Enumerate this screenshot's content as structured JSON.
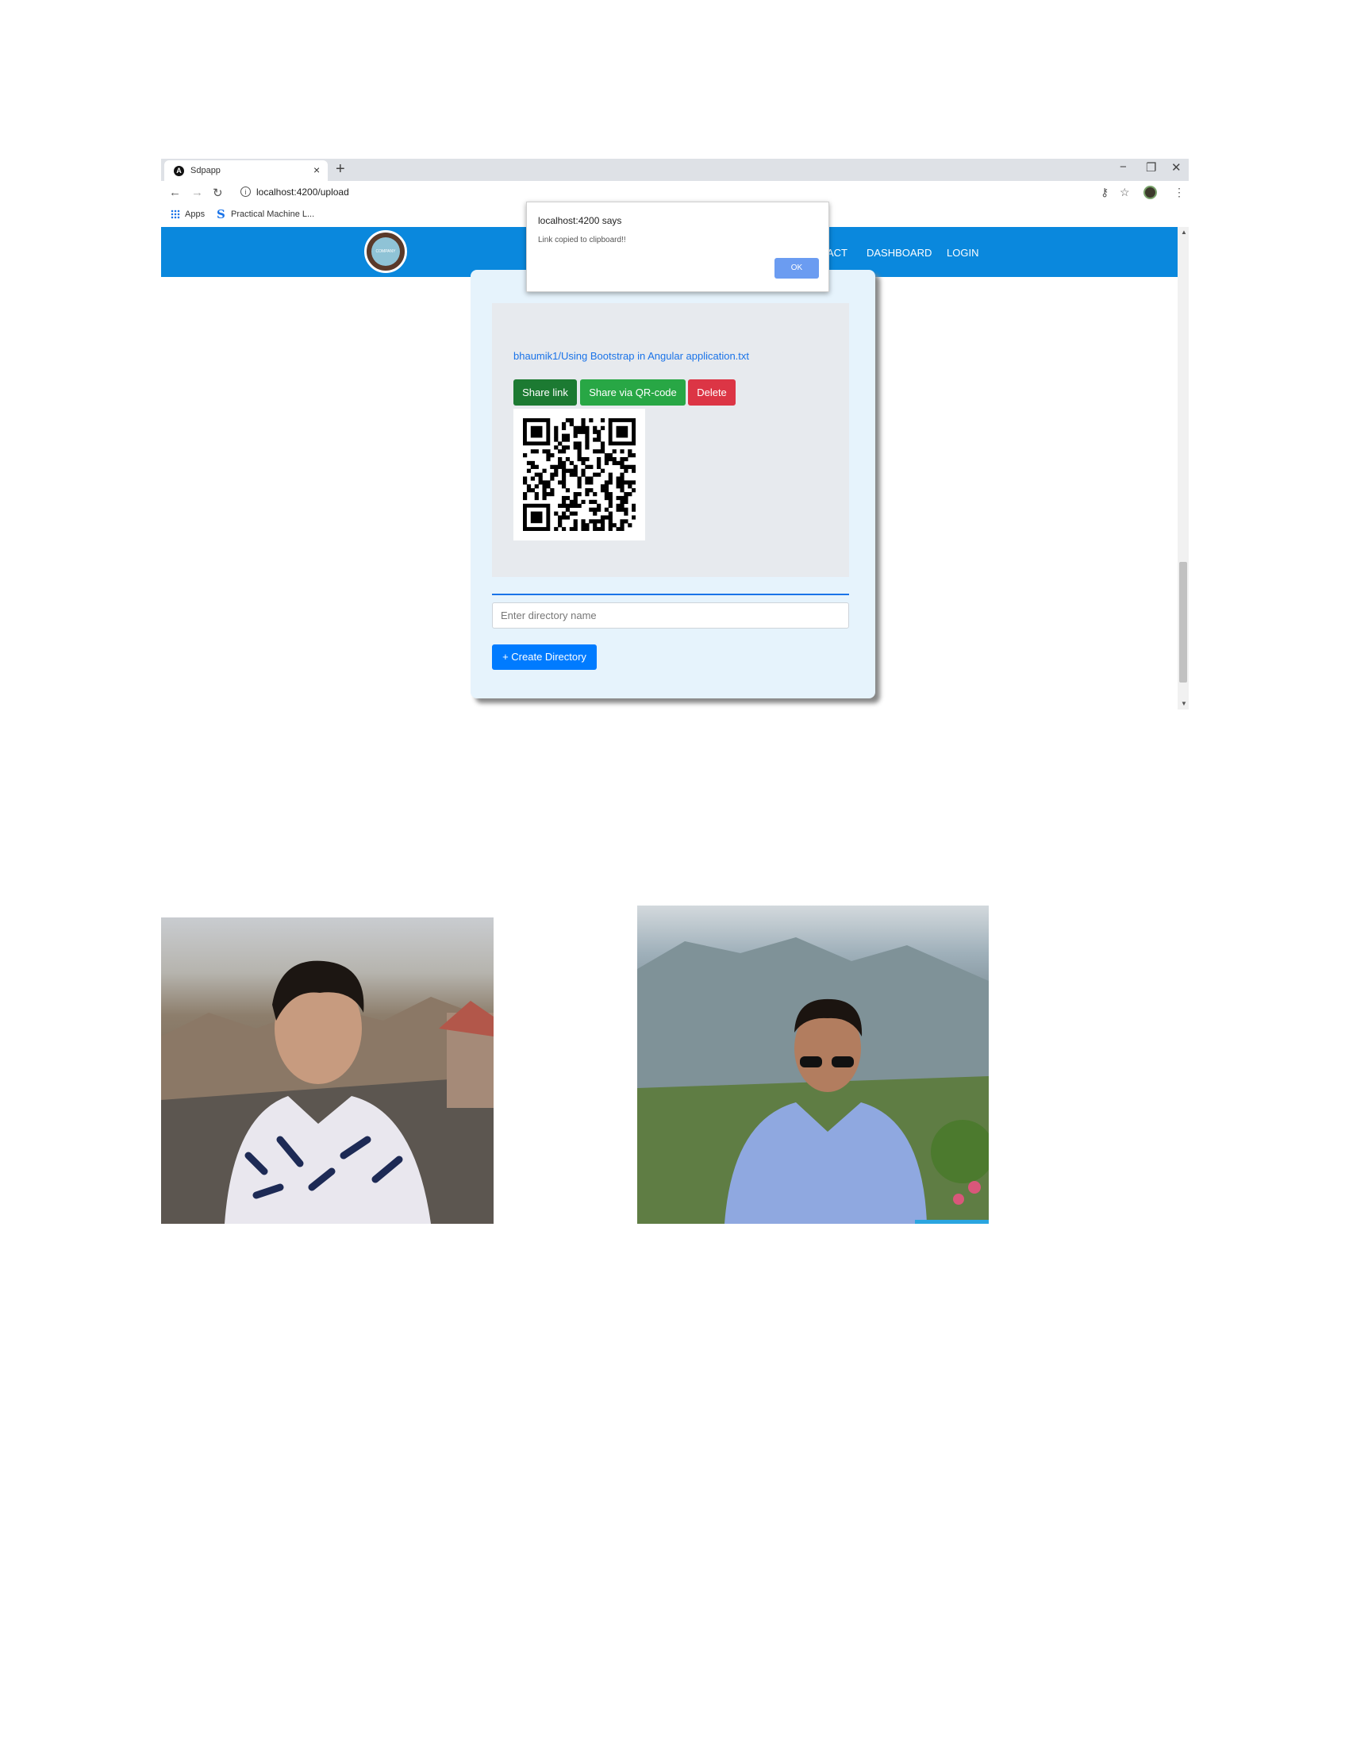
{
  "browser": {
    "tab_title": "Sdpapp",
    "tab_close": "×",
    "new_tab": "+",
    "window_controls": {
      "minimize": "−",
      "restore": "❐",
      "close": "✕"
    },
    "url": "localhost:4200/upload",
    "bookmarks": {
      "apps": "Apps",
      "item": "Practical Machine L..."
    }
  },
  "navbar": {
    "logo_text": "COMPANY LOGO",
    "links": [
      "TACT",
      "DASHBOARD",
      "LOGIN"
    ],
    "bg_color": "#0a88dd"
  },
  "alert": {
    "title": "localhost:4200 says",
    "message": "Link copied to clipboard!!",
    "ok": "OK"
  },
  "upload": {
    "file_path": "bhaumik1/Using Bootstrap in Angular application.txt",
    "buttons": {
      "share_link": "Share link",
      "share_qr": "Share via QR-code",
      "delete": "Delete"
    },
    "directory_placeholder": "Enter directory name",
    "create_directory": "+ Create Directory"
  },
  "colors": {
    "share_link": "#1c7a32",
    "share_qr": "#28a745",
    "delete": "#dc3545",
    "create": "#007bff",
    "link": "#1a73e8"
  },
  "icons": [
    "angular-favicon",
    "back-arrow-icon",
    "forward-arrow-icon",
    "reload-icon",
    "info-icon",
    "key-icon",
    "star-icon",
    "menu-dots-icon",
    "apps-grid-icon",
    "qr-code-image"
  ]
}
